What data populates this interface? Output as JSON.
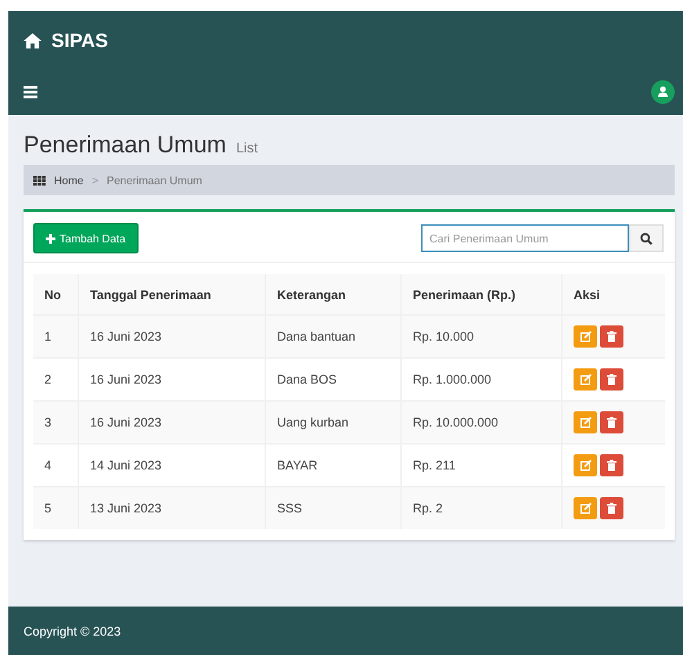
{
  "brand": "SIPAS",
  "page": {
    "title": "Penerimaan Umum",
    "subtitle": "List"
  },
  "breadcrumb": [
    "Home",
    ">",
    "Penerimaan Umum"
  ],
  "add_button": "Tambah Data",
  "search": {
    "placeholder": "Cari Penerimaan Umum"
  },
  "table": {
    "columns": [
      "No",
      "Tanggal Penerimaan",
      "Keterangan",
      "Penerimaan (Rp.)",
      "Aksi"
    ],
    "rows": [
      {
        "no": "1",
        "date": "16 Juni 2023",
        "note": "Dana bantuan",
        "amount": "Rp. 10.000"
      },
      {
        "no": "2",
        "date": "16 Juni 2023",
        "note": "Dana BOS",
        "amount": "Rp. 1.000.000"
      },
      {
        "no": "3",
        "date": "16 Juni 2023",
        "note": "Uang kurban",
        "amount": "Rp. 10.000.000"
      },
      {
        "no": "4",
        "date": "14 Juni 2023",
        "note": "BAYAR",
        "amount": "Rp. 211"
      },
      {
        "no": "5",
        "date": "13 Juni 2023",
        "note": "SSS",
        "amount": "Rp. 2"
      }
    ]
  },
  "footer": "Copyright © 2023"
}
